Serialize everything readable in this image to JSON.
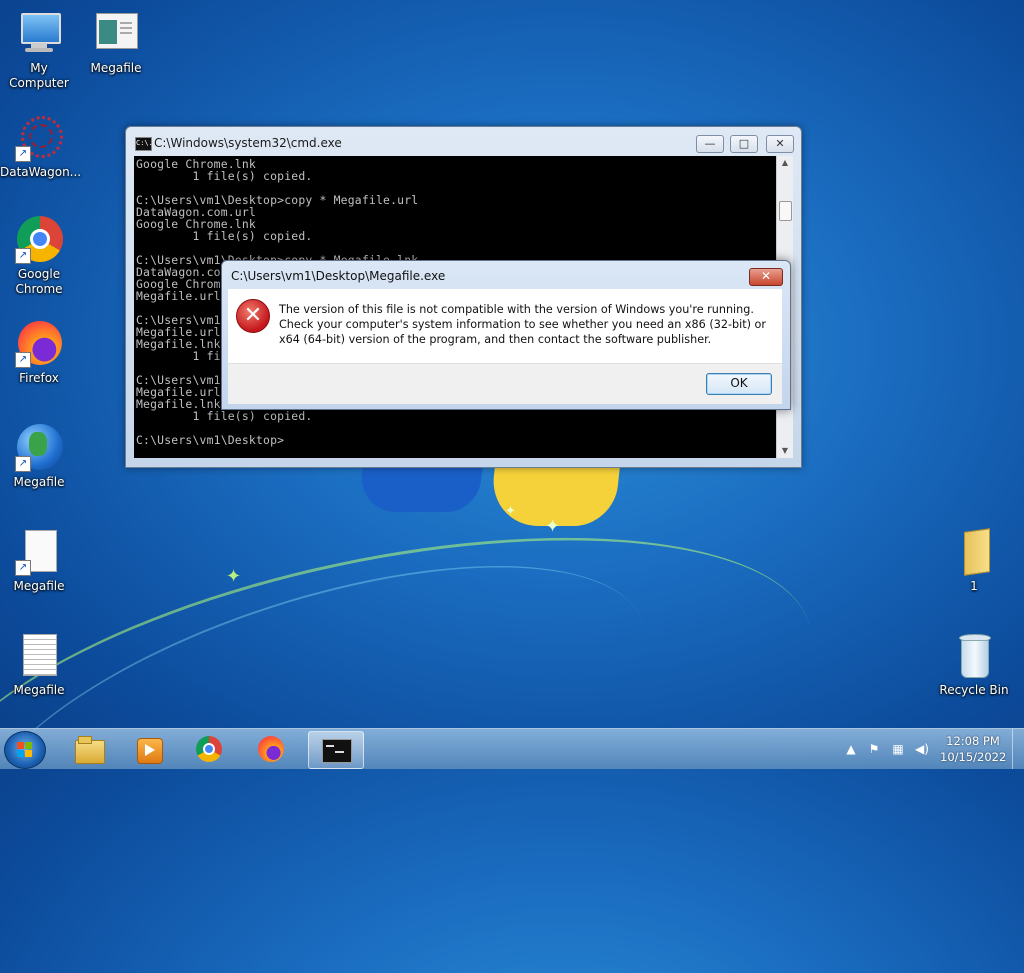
{
  "desktop": {
    "icons": [
      {
        "label": "My Computer",
        "icon": "computer-icon"
      },
      {
        "label": "Megafile",
        "icon": "window-app-icon"
      },
      {
        "label": "DataWagon...",
        "icon": "datawagon-icon"
      },
      {
        "label": "Google Chrome",
        "icon": "chrome-icon"
      },
      {
        "label": "Firefox",
        "icon": "firefox-icon"
      },
      {
        "label": "Megafile",
        "icon": "globe-icon"
      },
      {
        "label": "Megafile",
        "icon": "blank-file-icon"
      },
      {
        "label": "Megafile",
        "icon": "text-file-icon"
      },
      {
        "label": "1",
        "icon": "folder-icon"
      },
      {
        "label": "Recycle Bin",
        "icon": "recycle-bin-icon"
      }
    ]
  },
  "cmd": {
    "title": "C:\\Windows\\system32\\cmd.exe",
    "icon_text": "C:\\.",
    "lines": [
      "Google Chrome.lnk",
      "        1 file(s) copied.",
      "",
      "C:\\Users\\vm1\\Desktop>copy * Megafile.url",
      "DataWagon.com.url",
      "Google Chrome.lnk",
      "        1 file(s) copied.",
      "",
      "C:\\Users\\vm1\\Desktop>copy * Megafile.lnk",
      "DataWagon.com.url",
      "Google Chrome.lnk",
      "Megafile.url",
      "",
      "C:\\Users\\vm1\\Desktop>",
      "Megafile.url",
      "Megafile.lnk",
      "        1 file(s) copied.",
      "",
      "C:\\Users\\vm1\\Desktop>",
      "Megafile.url",
      "Megafile.lnk",
      "        1 file(s) copied.",
      "",
      "C:\\Users\\vm1\\Desktop>"
    ],
    "minimize": "—",
    "maximize": "□",
    "close": "✕"
  },
  "dialog": {
    "title": "C:\\Users\\vm1\\Desktop\\Megafile.exe",
    "message": "The version of this file is not compatible with the version of Windows you're running. Check your computer's system information to see whether you need an x86 (32-bit) or x64 (64-bit) version of the program, and then contact the software publisher.",
    "ok_label": "OK",
    "close": "✕",
    "error_glyph": "✕"
  },
  "taskbar": {
    "pinned": [
      {
        "name": "explorer",
        "icon": "folder-icon"
      },
      {
        "name": "media-player",
        "icon": "media-player-icon"
      },
      {
        "name": "chrome",
        "icon": "chrome-icon"
      },
      {
        "name": "firefox",
        "icon": "firefox-icon"
      },
      {
        "name": "cmd",
        "icon": "cmd-icon",
        "active": true
      }
    ],
    "time": "12:08 PM",
    "date": "10/15/2022"
  }
}
